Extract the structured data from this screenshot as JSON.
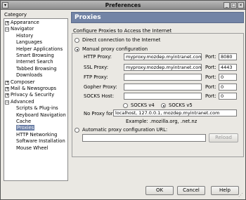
{
  "window": {
    "title": "Preferences"
  },
  "sidebar": {
    "label": "Category",
    "items": [
      {
        "label": "Appearance",
        "level": 0,
        "expander": "+"
      },
      {
        "label": "Navigator",
        "level": 0,
        "expander": "−"
      },
      {
        "label": "History",
        "level": 1
      },
      {
        "label": "Languages",
        "level": 1
      },
      {
        "label": "Helper Applications",
        "level": 1
      },
      {
        "label": "Smart Browsing",
        "level": 1
      },
      {
        "label": "Internet Search",
        "level": 1
      },
      {
        "label": "Tabbed Browsing",
        "level": 1
      },
      {
        "label": "Downloads",
        "level": 1
      },
      {
        "label": "Composer",
        "level": 0,
        "expander": "+"
      },
      {
        "label": "Mail & Newsgroups",
        "level": 0,
        "expander": "+"
      },
      {
        "label": "Privacy & Security",
        "level": 0,
        "expander": "+"
      },
      {
        "label": "Advanced",
        "level": 0,
        "expander": "−"
      },
      {
        "label": "Scripts & Plug-ins",
        "level": 1
      },
      {
        "label": "Keyboard Navigation",
        "level": 1
      },
      {
        "label": "Cache",
        "level": 1
      },
      {
        "label": "Proxies",
        "level": 1,
        "selected": true
      },
      {
        "label": "HTTP Networking",
        "level": 1
      },
      {
        "label": "Software Installation",
        "level": 1
      },
      {
        "label": "Mouse Wheel",
        "level": 1
      }
    ]
  },
  "panel": {
    "header": "Proxies",
    "section_title": "Configure Proxies to Access the Internet",
    "direct_label": "Direct connection to the Internet",
    "manual_label": "Manual proxy configuration",
    "port_label": "Port:",
    "proxies": [
      {
        "label": "HTTP Proxy:",
        "host": "myproxy.mozdep.myintranet.com",
        "port": "8080"
      },
      {
        "label": "SSL Proxy:",
        "host": "myproxy.mozdep.myintranet.com",
        "port": "4443"
      },
      {
        "label": "FTP Proxy:",
        "host": "",
        "port": "0"
      },
      {
        "label": "Gopher Proxy:",
        "host": "",
        "port": "0"
      },
      {
        "label": "SOCKS Host:",
        "host": "",
        "port": "0"
      }
    ],
    "socks_v4": "SOCKS v4",
    "socks_v5": "SOCKS v5",
    "no_proxy_label": "No Proxy for:",
    "no_proxy_value": "localhost, 127.0.0.1, mozdep.myintranet.com",
    "example": "Example: .mozilla.org, .net.nz",
    "auto_label": "Automatic proxy configuration URL:",
    "auto_url": "",
    "reload_label": "Reload"
  },
  "buttons": {
    "ok": "OK",
    "cancel": "Cancel",
    "help": "Help"
  }
}
